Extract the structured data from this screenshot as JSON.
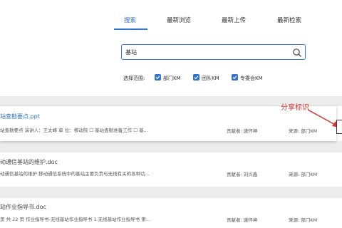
{
  "tabs": [
    {
      "label": "搜索",
      "active": true
    },
    {
      "label": "最新浏览",
      "active": false
    },
    {
      "label": "最新上传",
      "active": false
    },
    {
      "label": "最新检索",
      "active": false
    }
  ],
  "search": {
    "value": "基站",
    "icon": "search-icon"
  },
  "scope": {
    "label": "选择范围:",
    "options": [
      {
        "label": "部门KM",
        "checked": true
      },
      {
        "label": "团队KM",
        "checked": true
      },
      {
        "label": "专委会KM",
        "checked": true
      }
    ]
  },
  "results": [
    {
      "title": "站查勘要点.ppt",
      "snippet": "站查勘要点  演讲人：王太峰 单 位：移动院 ☐ 基站查勘准备工作 ☐ 基...",
      "contributor": "贡献者: 唐怀坤",
      "source": "来源: 部门KM"
    },
    {
      "title": "动通信基站的维护.doc",
      "snippet": "动通信基站的维护 移动通信系统中的基站主要负责与无线有关的各种功...",
      "contributor": "贡献者: 刘兴鑫",
      "source": "来源: 部门KM"
    },
    {
      "title": "站作业指导书.doc",
      "snippet": "页 共 22 页 作业指导书-无线基站作业指导书 1 无线基站作业指导书 第...",
      "contributor": "贡献者: 唐怀坤",
      "source": "来源: 部门KM"
    }
  ],
  "annotation": {
    "text": "分享标识",
    "color": "#e03030"
  },
  "colors": {
    "accent": "#2f73d0",
    "band": "#ececec"
  }
}
